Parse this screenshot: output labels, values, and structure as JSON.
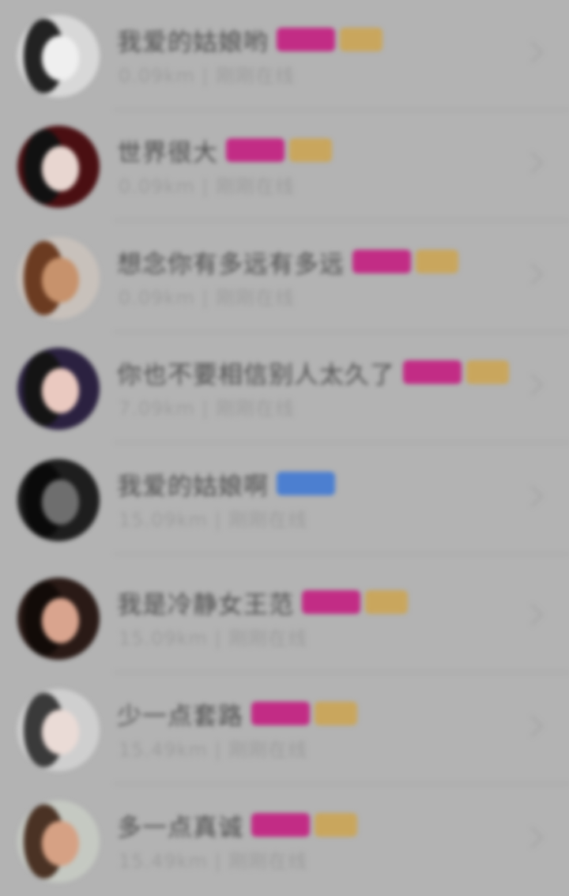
{
  "colors": {
    "background": "#b3b3b3",
    "name_text": "#4a4a4a",
    "meta_text": "#9c9c9c",
    "badge_pink": "#c22c85",
    "badge_gold": "#c9a65d",
    "badge_blue": "#4c7fd0"
  },
  "users": [
    {
      "name": "我爱的姑娘哟",
      "distance": "0.09km",
      "separator": "|",
      "time": "刚刚在线",
      "badges": [
        "pink",
        "gold"
      ],
      "avatar": {
        "bg": "#d8d8d8",
        "hair": "#222222",
        "face": "#efefef"
      }
    },
    {
      "name": "世界很大",
      "distance": "0.09km",
      "separator": "|",
      "time": "刚刚在线",
      "badges": [
        "pink",
        "gold"
      ],
      "avatar": {
        "bg": "#4a0f12",
        "hair": "#111111",
        "face": "#e8d6d0"
      }
    },
    {
      "name": "想念你有多远有多远",
      "distance": "0.09km",
      "separator": "|",
      "time": "刚刚在线",
      "badges": [
        "pink",
        "gold"
      ],
      "avatar": {
        "bg": "#c8c1bb",
        "hair": "#6b3b21",
        "face": "#c7926c"
      }
    },
    {
      "name": "你也不要相信别人太久了",
      "distance": "7.09km",
      "separator": "|",
      "time": "刚刚在线",
      "badges": [
        "pink",
        "gold"
      ],
      "avatar": {
        "bg": "#2b2140",
        "hair": "#141414",
        "face": "#eac9c0"
      }
    },
    {
      "name": "我爱的姑娘啊",
      "distance": "15.09km",
      "separator": "|",
      "time": "刚刚在线",
      "badges": [
        "blue"
      ],
      "avatar": {
        "bg": "#1e1e1e",
        "hair": "#0a0a0a",
        "face": "#6e6e6e"
      }
    },
    {
      "name": "我是冷静女王范",
      "distance": "15.09km",
      "separator": "|",
      "time": "刚刚在线",
      "badges": [
        "pink",
        "gold"
      ],
      "avatar": {
        "bg": "#2a1a16",
        "hair": "#120b08",
        "face": "#d9a48e"
      }
    },
    {
      "name": "少一点套路",
      "distance": "15.49km",
      "separator": "|",
      "time": "刚刚在线",
      "badges": [
        "pink",
        "gold"
      ],
      "avatar": {
        "bg": "#cfcfcf",
        "hair": "#3a3a3a",
        "face": "#eadbd6"
      }
    },
    {
      "name": "多一点真诚",
      "distance": "15.49km",
      "separator": "|",
      "time": "刚刚在线",
      "badges": [
        "pink",
        "gold"
      ],
      "avatar": {
        "bg": "#c5c9c2",
        "hair": "#4a3224",
        "face": "#d6a184"
      }
    }
  ]
}
